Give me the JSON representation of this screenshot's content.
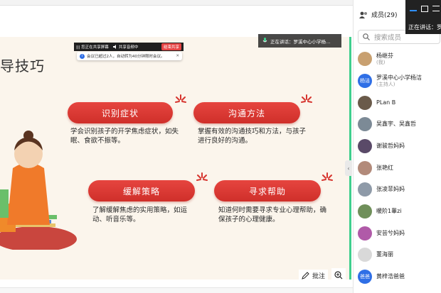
{
  "slide": {
    "title": "导技巧",
    "cards": [
      {
        "title": "识别症状",
        "desc": "学会识别孩子的开学焦虑症状，如失眠、食欲不振等。"
      },
      {
        "title": "沟通方法",
        "desc": "掌握有效的沟通技巧和方法，与孩子进行良好的沟通。"
      },
      {
        "title": "缓解策略",
        "desc": "了解缓解焦虑的实用策略，如运动、听音乐等。"
      },
      {
        "title": "寻求帮助",
        "desc": "知道何时需要寻求专业心理帮助，确保孩子的心理健康。"
      }
    ],
    "speaker_tag": "正在讲话：罗溪中心小学杨…"
  },
  "share_bar": {
    "sharing": "||| 您正在共享屏幕",
    "audio": "共享音频中",
    "end": "结束共享"
  },
  "notice": {
    "text": "会议已超过2人，自动转为40分钟限时会议。"
  },
  "annotate": {
    "label": "批注"
  },
  "panel": {
    "title": "成员(29)",
    "search_placeholder": "搜索成员",
    "members": [
      {
        "name": "杨继芬",
        "role": "(我)",
        "color": "#c8a070",
        "initial": ""
      },
      {
        "name": "罗溪中心小学杨洁",
        "role": "(主持人)",
        "color": "#2f6fe6",
        "initial": "杨洁"
      },
      {
        "name": "PLan  B",
        "role": "",
        "color": "#6a5a4a",
        "initial": ""
      },
      {
        "name": "吴鑫宇、吴鑫哲",
        "role": "",
        "color": "#7c8a96",
        "initial": ""
      },
      {
        "name": "谢骏哲妈妈",
        "role": "",
        "color": "#5a4a68",
        "initial": ""
      },
      {
        "name": "张艳红",
        "role": "",
        "color": "#b28a7a",
        "initial": ""
      },
      {
        "name": "张凌菲妈妈",
        "role": "",
        "color": "#8e9aa8",
        "initial": ""
      },
      {
        "name": "暖阶1睾zi",
        "role": "",
        "color": "#6f8f5a",
        "initial": ""
      },
      {
        "name": "安芸兮妈妈",
        "role": "",
        "color": "#b05aa8",
        "initial": ""
      },
      {
        "name": "董海丽",
        "role": "",
        "color": "#d9d9d9",
        "initial": ""
      },
      {
        "name": "黄梓浩爸爸",
        "role": "",
        "color": "#2f6fe6",
        "initial": "爸爸"
      }
    ]
  },
  "floating": {
    "speaking": "正在讲话：罗"
  }
}
